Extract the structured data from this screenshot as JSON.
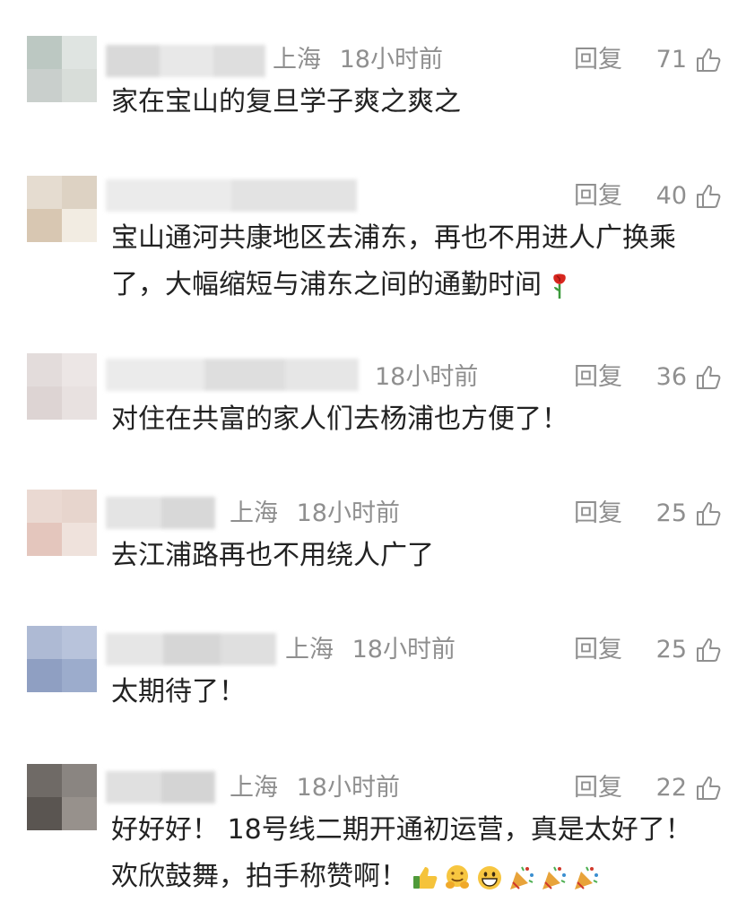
{
  "comments": [
    {
      "location": "上海",
      "time": "18小时前",
      "reply_label": "回复",
      "likes": "71",
      "text": "家在宝山的复旦学子爽之爽之",
      "avatar_colors": [
        "#bcc8c2",
        "#dfe4e1",
        "#c9cfcc",
        "#d8ddd9"
      ]
    },
    {
      "location": "",
      "time": "",
      "reply_label": "回复",
      "likes": "40",
      "text_lines": [
        "宝山通河共康地区去浦东，再也不用进人广换乘",
        "了，大幅缩短与浦东之间的通勤时间"
      ],
      "emoji": "rose-emoji",
      "avatar_colors": [
        "#e5dcd0",
        "#ddd2c3",
        "#d8c7b2",
        "#f2ece2"
      ]
    },
    {
      "location": "",
      "time": "18小时前",
      "reply_label": "回复",
      "likes": "36",
      "text": "对住在共富的家人们去杨浦也方便了！",
      "avatar_colors": [
        "#e3dcdb",
        "#ece6e5",
        "#ddd4d3",
        "#e8e1e0"
      ]
    },
    {
      "location": "上海",
      "time": "18小时前",
      "reply_label": "回复",
      "likes": "25",
      "text": "去江浦路再也不用绕人广了",
      "avatar_colors": [
        "#ead9d2",
        "#e7d5cd",
        "#e4c6bd",
        "#efe2dc"
      ]
    },
    {
      "location": "上海",
      "time": "18小时前",
      "reply_label": "回复",
      "likes": "25",
      "text": "太期待了！",
      "avatar_colors": [
        "#aebad4",
        "#b8c3db",
        "#8f9fc2",
        "#9caccc"
      ]
    },
    {
      "location": "上海",
      "time": "18小时前",
      "reply_label": "回复",
      "likes": "22",
      "text_lines": [
        "好好好！ 18号线二期开通初运营，真是太好了！",
        "欢欣鼓舞，拍手称赞啊！"
      ],
      "emojis": [
        "thumbs-up-emoji",
        "hugging-face-emoji",
        "grinning-face-emoji",
        "party-popper-emoji",
        "party-popper-emoji",
        "party-popper-emoji"
      ],
      "avatar_colors": [
        "#6f6a66",
        "#8a8581",
        "#5a5551",
        "#97918c"
      ]
    }
  ]
}
